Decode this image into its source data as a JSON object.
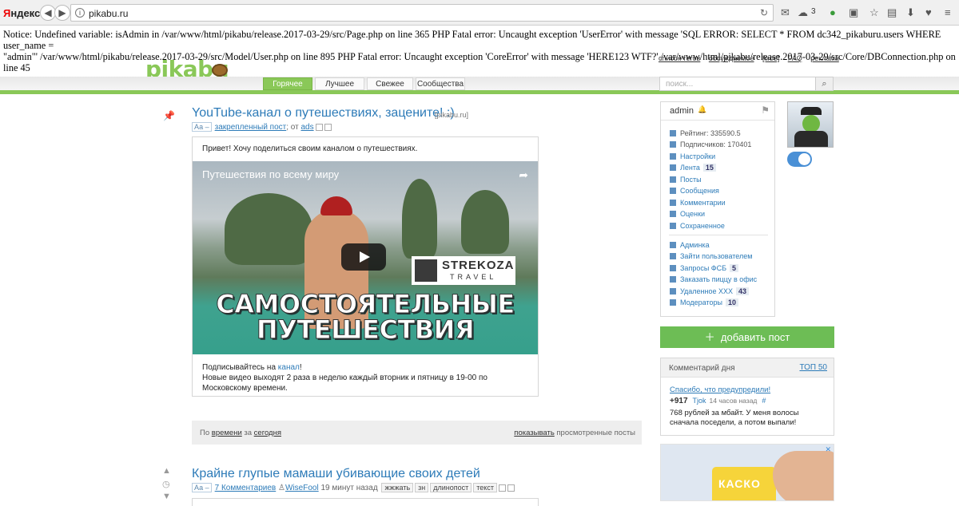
{
  "browser": {
    "brand_first": "Я",
    "brand_rest": "ндекс",
    "url": "pikabu.ru",
    "mail_count": "3"
  },
  "notice": {
    "line1": "Notice: Undefined variable: isAdmin in /var/www/html/pikabu/release.2017-03-29/src/Page.php on line 365 PHP Fatal error: Uncaught exception 'UserError' with message 'SQL ERROR: SELECT * FROM dc342_pikaburu.users WHERE user_name =",
    "line2": "\"admin\"' /var/www/html/pikabu/release.2017-03-29/src/Model/User.php on line 895 PHP Fatal error: Uncaught exception 'CoreError' with message 'HERE123 WTF?' /var/www/html/pikabu/release.2017-03-29/src/Core/DBConnection.php on line 45"
  },
  "site": {
    "logo": "pikabu",
    "top_links": [
      "список тегов",
      "обсуждаемое",
      "[моё]",
      "FAQ",
      "реклама"
    ],
    "tabs": [
      "Горячее",
      "Лучшее",
      "Свежее",
      "Сообщества"
    ],
    "search_placeholder": "поиск..."
  },
  "post1": {
    "title": "YouTube-канал о путешествиях, зацените! :)",
    "source": "[pikabu.ru]",
    "aa": "Аа –",
    "pinned": "закрепленный пост",
    "from": "; от",
    "author": "ads",
    "intro": "Привет! Хочу поделиться своим каналом о путешествиях.",
    "video_title": "Путешествия по всему миру",
    "brand1": "STREKOZA",
    "brand2": "TRAVEL",
    "big1": "САМОСТОЯТЕЛЬНЫЕ",
    "big2": "ПУТЕШЕСТВИЯ",
    "foot_pre": "Подписывайтесь на ",
    "foot_link": "канал",
    "foot_post": "!",
    "foot2": "Новые видео выходят 2 раза в неделю каждый вторник и пятницу в 19-00 по Московскому времени."
  },
  "sortbar": {
    "by": "По",
    "time": "времени",
    "for": "за",
    "today": "сегодня",
    "show": "показывать",
    "viewed": "просмотренные посты"
  },
  "post2": {
    "title": "Крайне глупые мамаши убивающие своих детей",
    "aa": "Аа –",
    "comments": "7 Комментариев",
    "author": "WiseFool",
    "time": "19 минут назад",
    "tags": [
      "жжжать",
      "зн",
      "длинопост",
      "текст"
    ]
  },
  "user": {
    "name": "admin",
    "rating": "Рейтинг: 335590.5",
    "subscribers": "Подписчиков: 170401",
    "menu": [
      {
        "label": "Настройки",
        "count": ""
      },
      {
        "label": "Лента",
        "count": "15"
      },
      {
        "label": "Посты",
        "count": ""
      },
      {
        "label": "Сообщения",
        "count": ""
      },
      {
        "label": "Комментарии",
        "count": ""
      },
      {
        "label": "Оценки",
        "count": ""
      },
      {
        "label": "Сохраненное",
        "count": ""
      }
    ],
    "admin_menu": [
      {
        "label": "Админка",
        "count": ""
      },
      {
        "label": "Зайти пользователем",
        "count": ""
      },
      {
        "label": "Запросы ФСБ",
        "count": "5"
      },
      {
        "label": "Заказать пиццу в офис",
        "count": ""
      },
      {
        "label": "Удаленное XXX",
        "count": "43"
      },
      {
        "label": "Модераторы",
        "count": "10"
      }
    ]
  },
  "add_post": "добавить пост",
  "comment_day": {
    "title": "Комментарий дня",
    "top": "ТОП 50",
    "link": "Спасибо, что предупредили!",
    "rating": "+917",
    "author": "Tjok",
    "time": "14 часов назад",
    "hash": "#",
    "text": "768 рублей за мбайт. У меня волосы сначала поседели, а потом выпали!"
  },
  "ad": {
    "title": "КАСКО"
  },
  "colors": {
    "accent_green": "#8ac858",
    "link_blue": "#2d7bb8",
    "add_button": "#6dbd55"
  }
}
